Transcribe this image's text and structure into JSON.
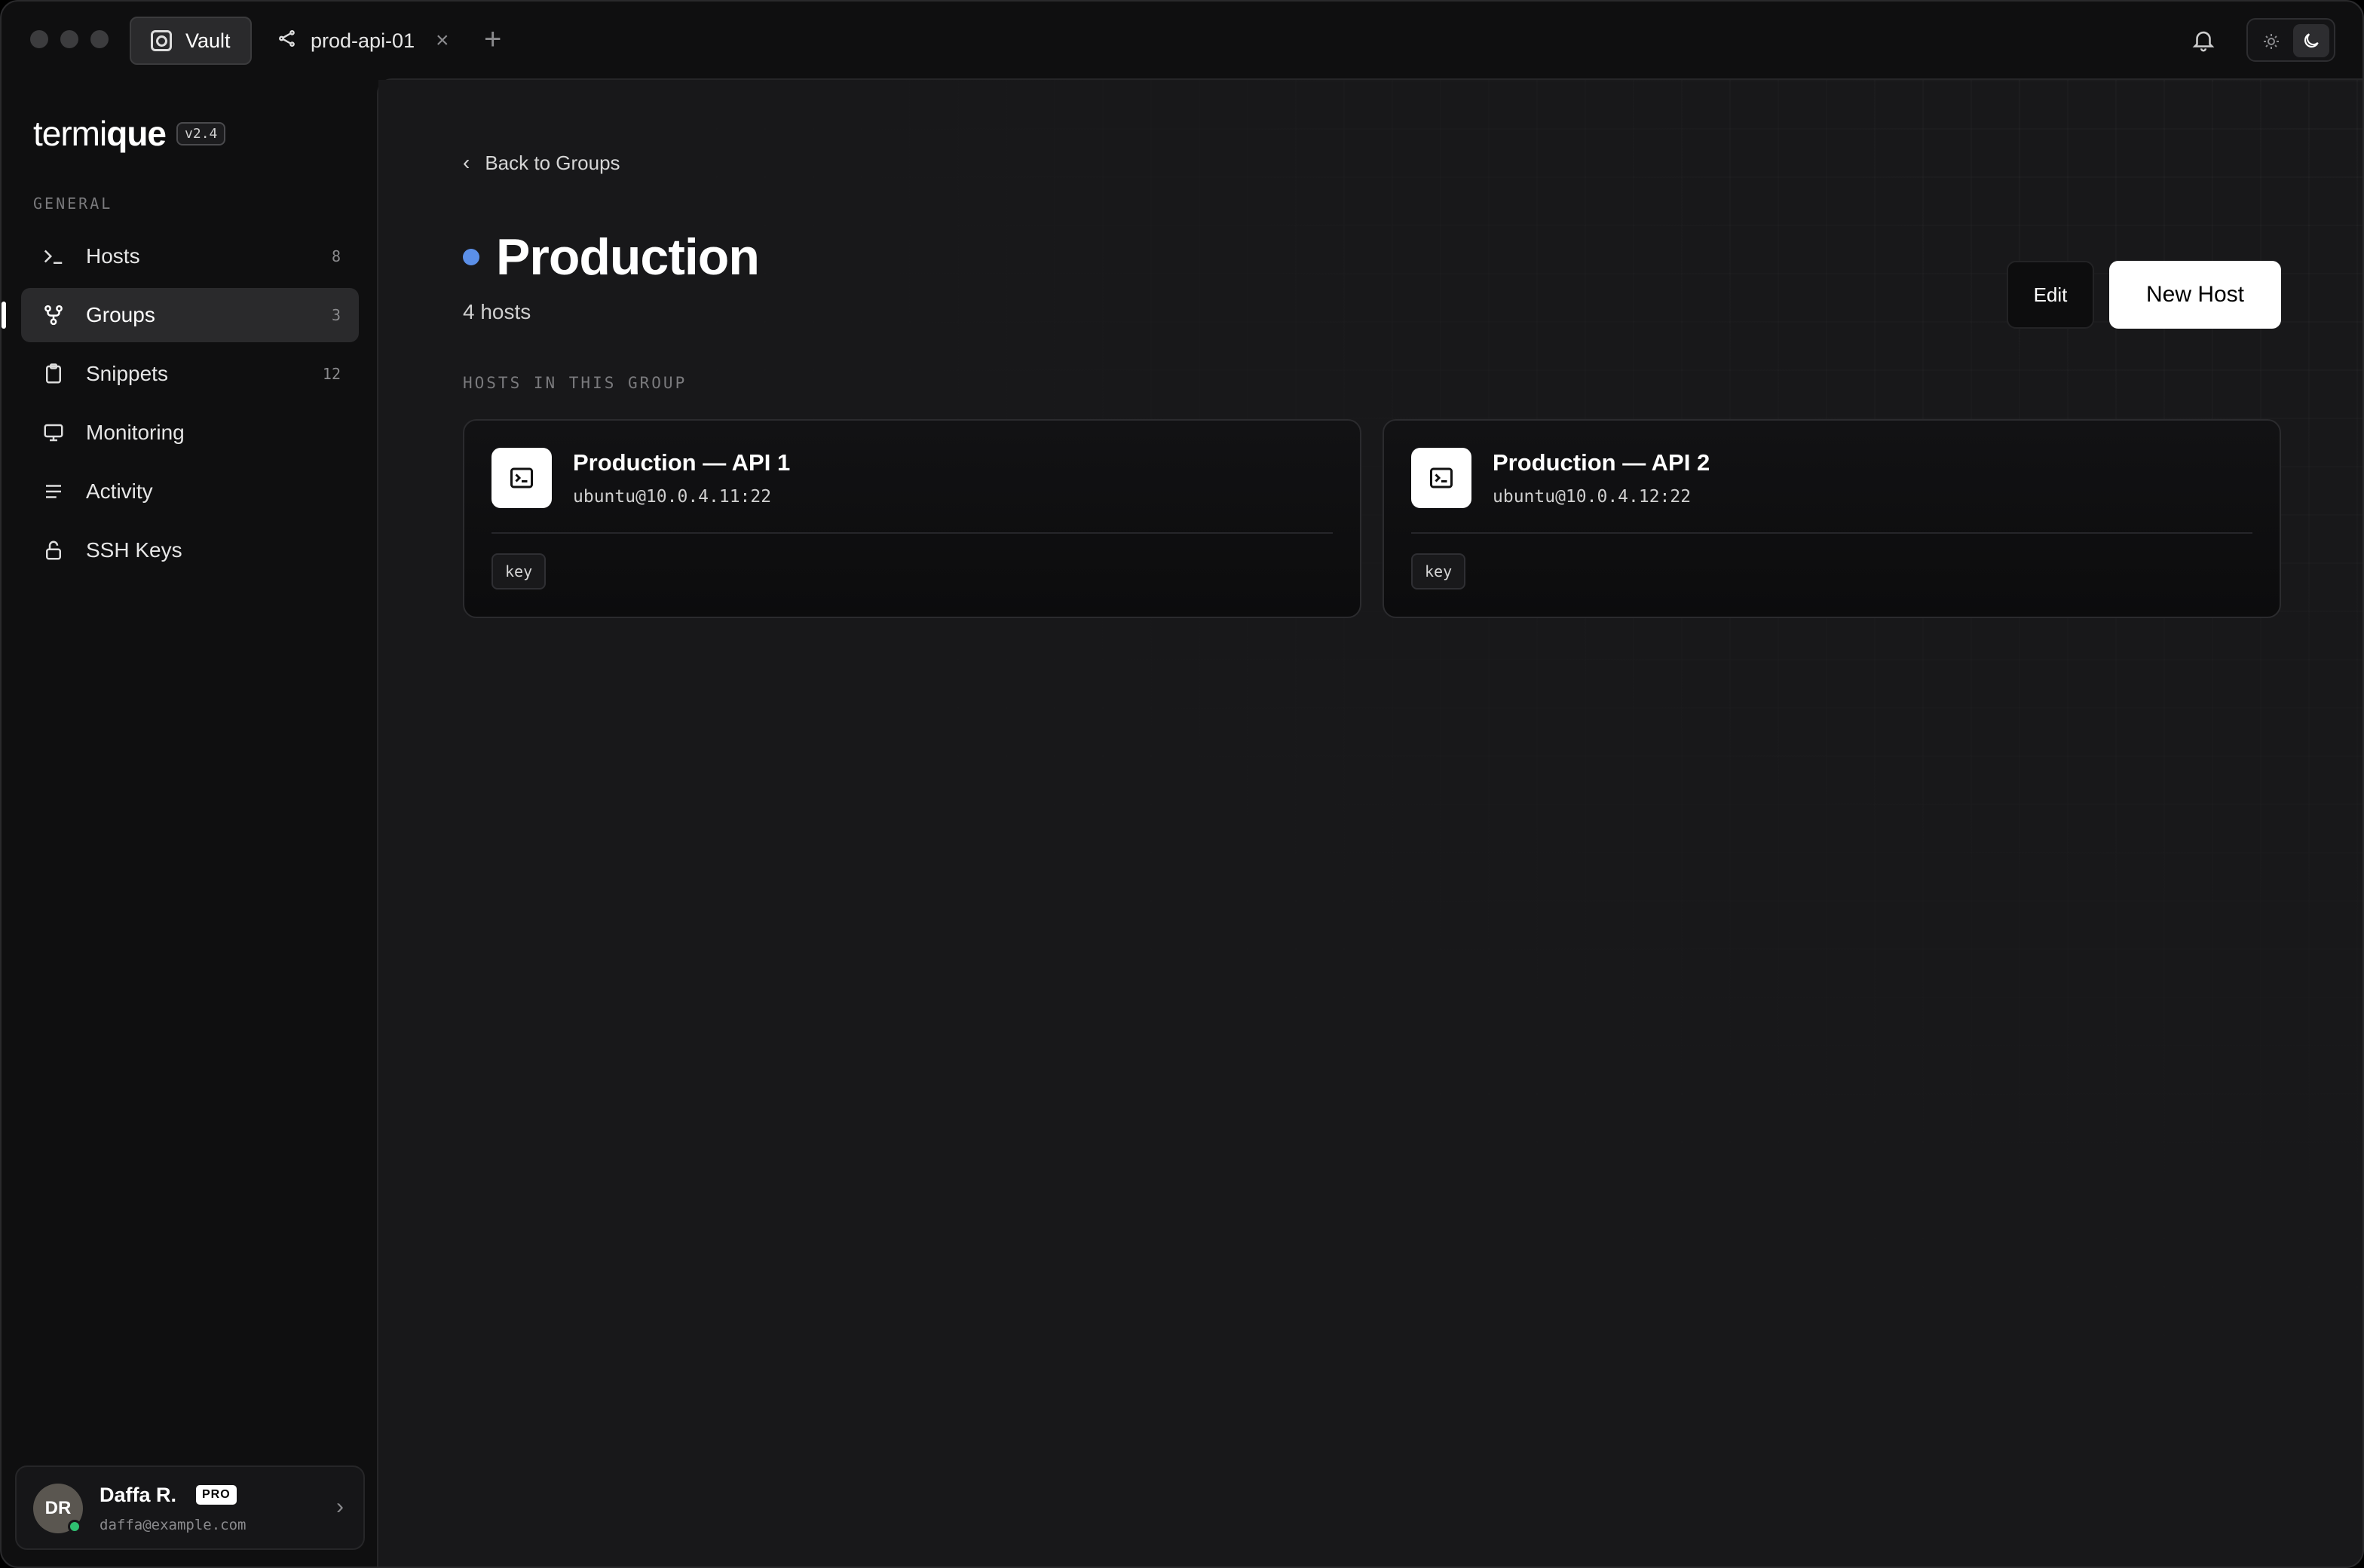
{
  "tabs": {
    "vault_label": "Vault",
    "host_tab_label": "prod-api-01",
    "close_glyph": "×",
    "add_glyph": "+"
  },
  "brand": {
    "name_light": "termi",
    "name_bold": "que",
    "version": "v2.4"
  },
  "sidebar": {
    "section_label": "GENERAL",
    "items": [
      {
        "label": "Hosts",
        "count": "8",
        "icon": "terminal-prompt-icon"
      },
      {
        "label": "Groups",
        "count": "3",
        "icon": "groups-icon",
        "active": true
      },
      {
        "label": "Snippets",
        "count": "12",
        "icon": "clipboard-icon"
      },
      {
        "label": "Monitoring",
        "count": "",
        "icon": "monitor-icon"
      },
      {
        "label": "Activity",
        "count": "",
        "icon": "lines-icon"
      },
      {
        "label": "SSH Keys",
        "count": "",
        "icon": "lock-icon"
      }
    ]
  },
  "user": {
    "initials": "DR",
    "name": "Daffa R.",
    "badge": "PRO",
    "email": "daffa@example.com"
  },
  "main": {
    "back_label": "Back to Groups",
    "title": "Production",
    "host_count": "4 hosts",
    "edit_label": "Edit",
    "new_host_label": "New Host",
    "section_label": "HOSTS IN THIS GROUP",
    "cards": [
      {
        "name": "Production — API 1",
        "address": "ubuntu@10.0.4.11:22",
        "tag": "key"
      },
      {
        "name": "Production — API 2",
        "address": "ubuntu@10.0.4.12:22",
        "tag": "key"
      }
    ]
  },
  "colors": {
    "status_dot": "#5b8fe8",
    "online": "#2fbf71",
    "background": "#18181a",
    "sidebar": "#0f0f10"
  }
}
